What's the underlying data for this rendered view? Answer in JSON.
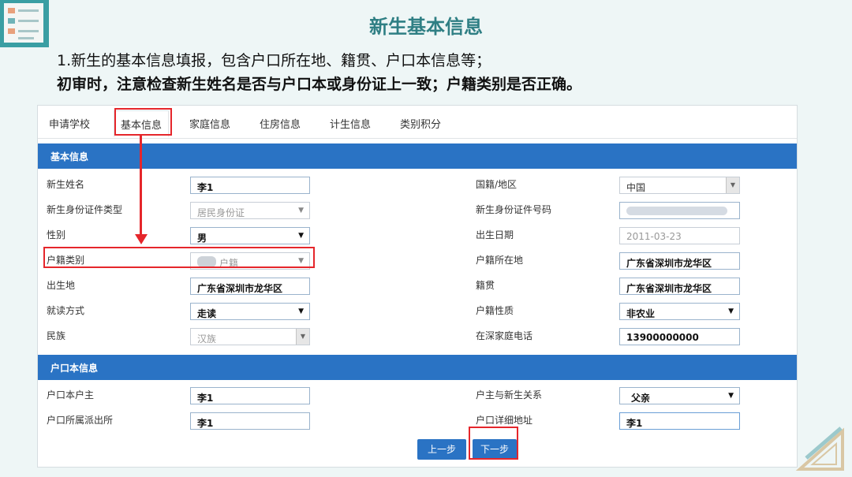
{
  "slide": {
    "title": "新生基本信息",
    "note_line1": "1.新生的基本信息填报，包含户口所在地、籍贯、户口本信息等；",
    "note_line2": "初审时，注意检查新生姓名是否与户口本或身份证上一致；户籍类别是否正确。"
  },
  "tabs": [
    "申请学校",
    "基本信息",
    "家庭信息",
    "住房信息",
    "计生信息",
    "类别积分"
  ],
  "active_tab": "基本信息",
  "basic_section": {
    "title": "基本信息",
    "student_name_label": "新生姓名",
    "student_name_value": "李1",
    "id_type_label": "新生身份证件类型",
    "id_type_value": "居民身份证",
    "gender_label": "性别",
    "gender_value": "男",
    "hukou_type_label": "户籍类别",
    "hukou_type_value": "户籍",
    "birthplace_label": "出生地",
    "birthplace_value": "广东省深圳市龙华区",
    "study_mode_label": "就读方式",
    "study_mode_value": "走读",
    "ethnicity_label": "民族",
    "ethnicity_value": "汉族",
    "nationality_label": "国籍/地区",
    "nationality_value": "中国",
    "id_number_label": "新生身份证件号码",
    "id_number_value": "",
    "birth_date_label": "出生日期",
    "birth_date_value": "2011-03-23",
    "hukou_location_label": "户籍所在地",
    "hukou_location_value": "广东省深圳市龙华区",
    "native_place_label": "籍贯",
    "native_place_value": "广东省深圳市龙华区",
    "hukou_nature_label": "户籍性质",
    "hukou_nature_value": "非农业",
    "home_phone_label": "在深家庭电话",
    "home_phone_value": "13900000000"
  },
  "hukou_section": {
    "title": "户口本信息",
    "holder_label": "户口本户主",
    "holder_value": "李1",
    "police_station_label": "户口所属派出所",
    "police_station_value": "李1",
    "relation_label": "户主与新生关系",
    "relation_value": "父亲",
    "address_label": "户口详细地址",
    "address_value": "李1"
  },
  "buttons": {
    "prev": "上一步",
    "next": "下一步"
  },
  "colors": {
    "section_bar": "#2a73c4",
    "highlight": "#e5262b",
    "title": "#2f7f84"
  },
  "icons": {
    "dropdown": "▼",
    "spinner": "▼"
  }
}
